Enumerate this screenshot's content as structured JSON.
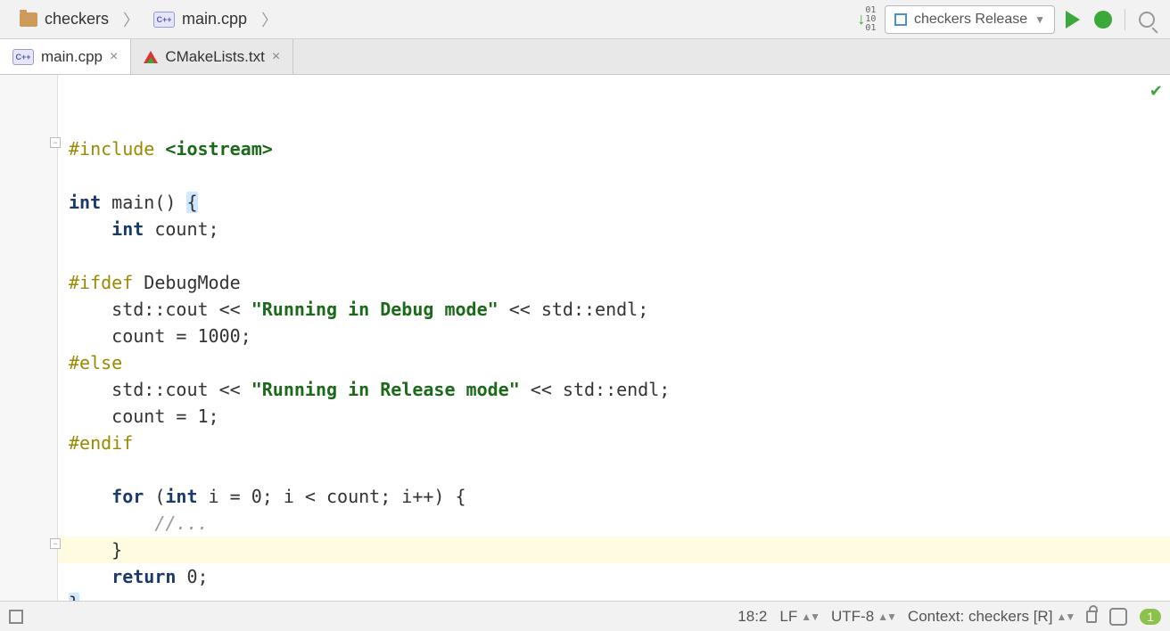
{
  "breadcrumb": {
    "project": "checkers",
    "file": "main.cpp"
  },
  "toolbar": {
    "run_config": "checkers Release"
  },
  "tabs": [
    {
      "label": "main.cpp",
      "active": true,
      "icon": "cpp"
    },
    {
      "label": "CMakeLists.txt",
      "active": false,
      "icon": "cmake"
    }
  ],
  "code": {
    "l1_include": "#include",
    "l1_header": "<iostream>",
    "l3_int": "int",
    "l3_main": "main()",
    "l3_brace": "{",
    "l4_int": "int",
    "l4_rest": " count;",
    "l6_ifdef": "#ifdef",
    "l6_sym": " DebugMode",
    "l7_pre": "    std::cout << ",
    "l7_str": "\"Running in Debug mode\"",
    "l7_post": " << std::endl;",
    "l8": "    count = 1000;",
    "l9_else": "#else",
    "l10_pre": "    std::cout << ",
    "l10_str": "\"Running in Release mode\"",
    "l10_post": " << std::endl;",
    "l11": "    count = 1;",
    "l12_endif": "#endif",
    "l14_for": "for",
    "l14_open": " (",
    "l14_int": "int",
    "l14_rest": " i = 0; i < count; i++) {",
    "l15_com": "        //...",
    "l16": "    }",
    "l17_ret": "return",
    "l17_rest": " 0;",
    "l18_close": "}"
  },
  "status": {
    "pos": "18:2",
    "line_sep": "LF",
    "encoding": "UTF-8",
    "context": "Context: checkers [R]",
    "badge": "1"
  }
}
